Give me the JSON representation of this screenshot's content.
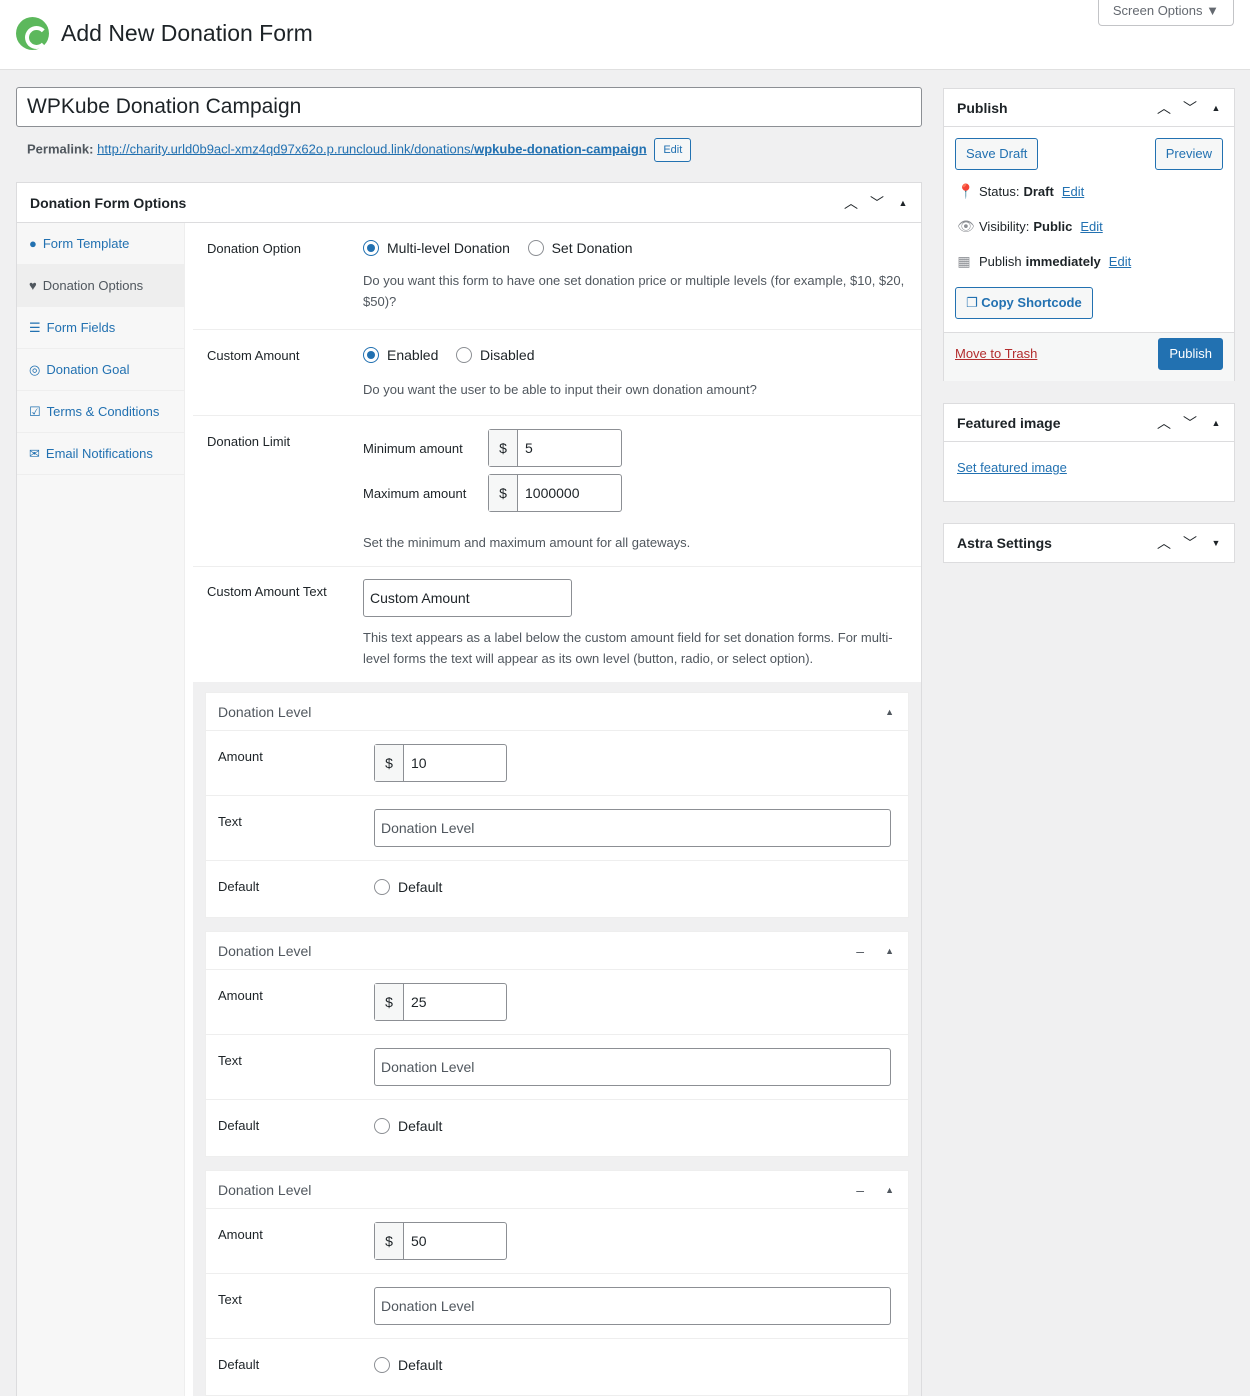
{
  "header": {
    "title": "Add New Donation Form",
    "screen_options": "Screen Options"
  },
  "post": {
    "title": "WPKube Donation Campaign",
    "permalink_label": "Permalink:",
    "permalink_base": "http://charity.urld0b9acl-xmz4qd97x62o.p.runcloud.link/donations/",
    "permalink_slug": "wpkube-donation-campaign",
    "edit_label": "Edit"
  },
  "options": {
    "title": "Donation Form Options",
    "sidebar": [
      {
        "label": "Form Template",
        "icon": "palette-icon"
      },
      {
        "label": "Donation Options",
        "icon": "heart-icon"
      },
      {
        "label": "Form Fields",
        "icon": "list-icon"
      },
      {
        "label": "Donation Goal",
        "icon": "target-icon"
      },
      {
        "label": "Terms & Conditions",
        "icon": "checkbox-icon"
      },
      {
        "label": "Email Notifications",
        "icon": "envelope-icon"
      }
    ],
    "donation_option": {
      "label": "Donation Option",
      "choice1": "Multi-level Donation",
      "choice2": "Set Donation",
      "selected": "Multi-level Donation",
      "desc": "Do you want this form to have one set donation price or multiple levels (for example, $10, $20, $50)?"
    },
    "custom_amount": {
      "label": "Custom Amount",
      "choice1": "Enabled",
      "choice2": "Disabled",
      "selected": "Enabled",
      "desc": "Do you want the user to be able to input their own donation amount?"
    },
    "limit": {
      "label": "Donation Limit",
      "min_label": "Minimum amount",
      "min_value": "5",
      "max_label": "Maximum amount",
      "max_value": "1000000",
      "currency": "$",
      "desc": "Set the minimum and maximum amount for all gateways."
    },
    "custom_text": {
      "label": "Custom Amount Text",
      "value": "Custom Amount",
      "desc": "This text appears as a label below the custom amount field for set donation forms. For multi-level forms the text will appear as its own level (button, radio, or select option)."
    },
    "levels": [
      {
        "title": "Donation Level",
        "amount_label": "Amount",
        "amount": "10",
        "text_label": "Text",
        "text_placeholder": "Donation Level",
        "default_label": "Default",
        "default_option": "Default"
      },
      {
        "title": "Donation Level",
        "amount_label": "Amount",
        "amount": "25",
        "text_label": "Text",
        "text_placeholder": "Donation Level",
        "default_label": "Default",
        "default_option": "Default"
      },
      {
        "title": "Donation Level",
        "amount_label": "Amount",
        "amount": "50",
        "text_label": "Text",
        "text_placeholder": "Donation Level",
        "default_label": "Default",
        "default_option": "Default"
      }
    ]
  },
  "publish": {
    "title": "Publish",
    "save_draft": "Save Draft",
    "preview": "Preview",
    "status_label": "Status:",
    "status": "Draft",
    "visibility_label": "Visibility:",
    "visibility": "Public",
    "publish_label": "Publish",
    "publish_when": "immediately",
    "edit": "Edit",
    "copy_shortcode": "Copy Shortcode",
    "trash": "Move to Trash",
    "publish_btn": "Publish"
  },
  "featured": {
    "title": "Featured image",
    "link": "Set featured image"
  },
  "astra": {
    "title": "Astra Settings"
  },
  "colors": {
    "accent": "#2271b1",
    "logo": "#5cb85c"
  }
}
